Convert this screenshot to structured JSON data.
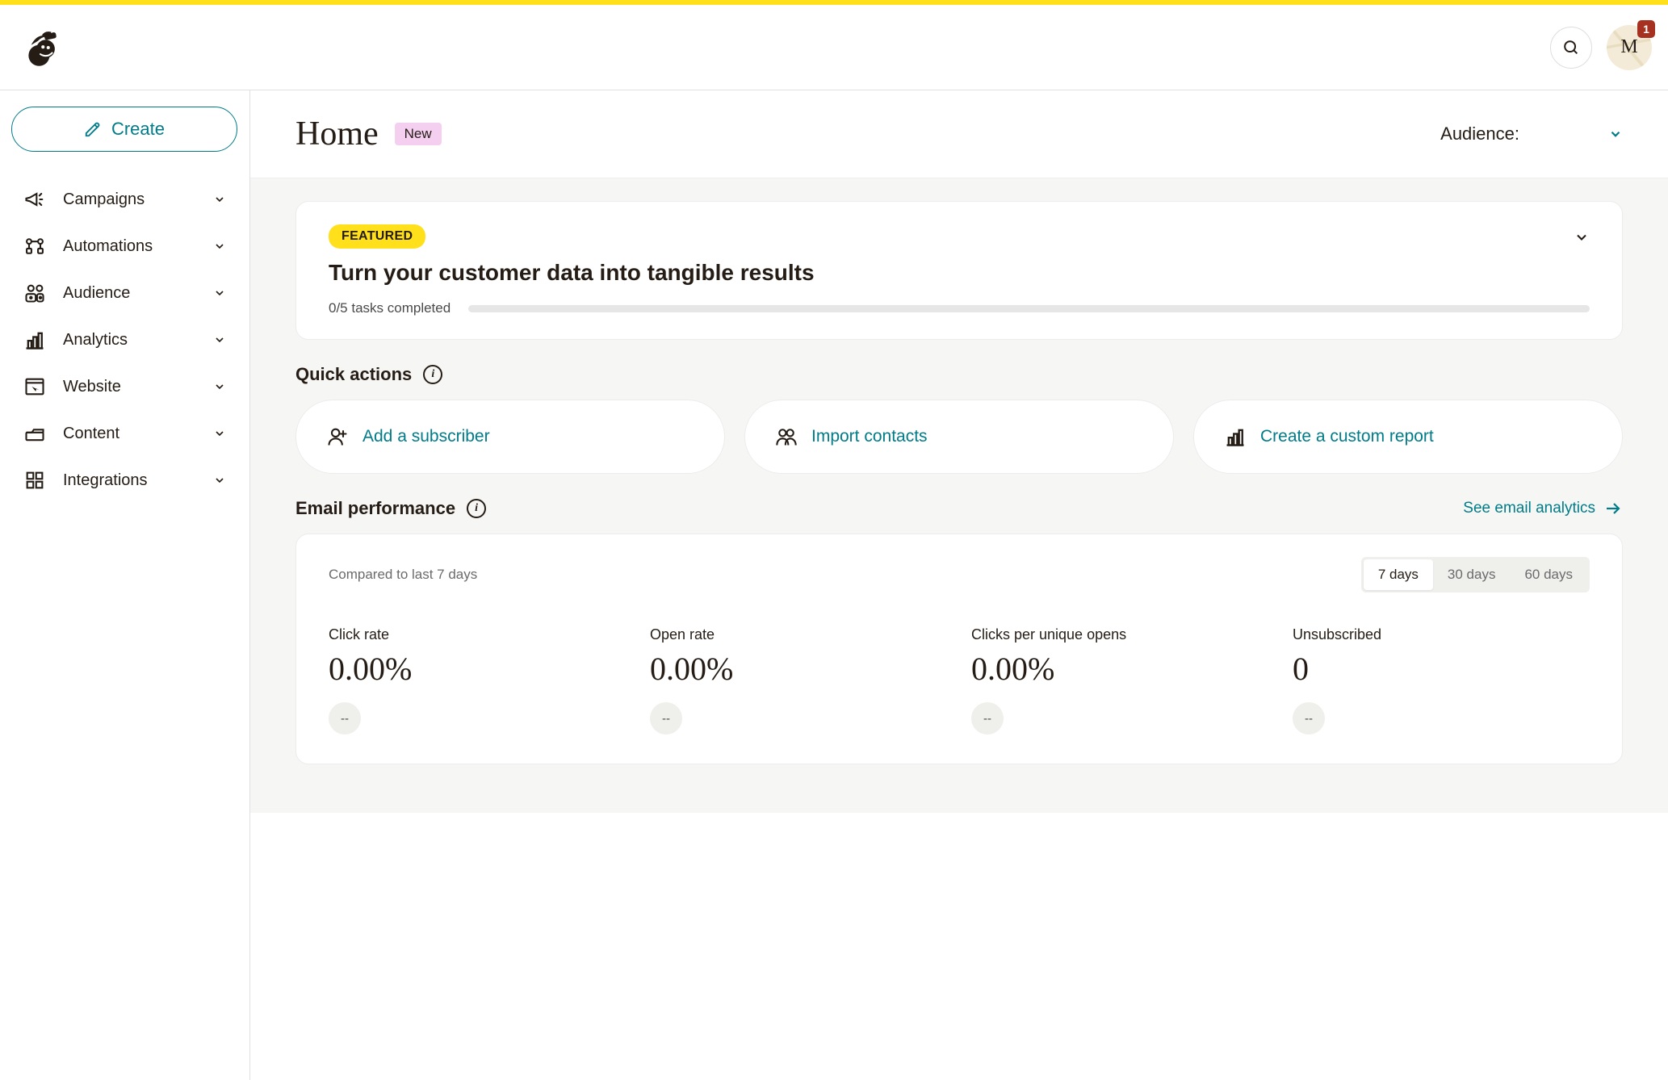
{
  "header": {
    "avatar_letter": "M",
    "badge_count": "1"
  },
  "sidebar": {
    "create_label": "Create",
    "items": [
      {
        "label": "Campaigns"
      },
      {
        "label": "Automations"
      },
      {
        "label": "Audience"
      },
      {
        "label": "Analytics"
      },
      {
        "label": "Website"
      },
      {
        "label": "Content"
      },
      {
        "label": "Integrations"
      }
    ]
  },
  "main": {
    "title": "Home",
    "new_badge": "New",
    "audience_label": "Audience:"
  },
  "featured": {
    "tag": "FEATURED",
    "title": "Turn your customer data into tangible results",
    "progress_text": "0/5 tasks completed"
  },
  "quick_actions": {
    "title": "Quick actions",
    "items": [
      {
        "label": "Add a subscriber"
      },
      {
        "label": "Import contacts"
      },
      {
        "label": "Create a custom report"
      }
    ]
  },
  "email_perf": {
    "title": "Email performance",
    "see_link": "See email analytics",
    "compared_text": "Compared to last 7 days",
    "tabs": [
      {
        "label": "7 days",
        "active": true
      },
      {
        "label": "30 days",
        "active": false
      },
      {
        "label": "60 days",
        "active": false
      }
    ],
    "metrics": [
      {
        "label": "Click rate",
        "value": "0.00%",
        "delta": "--"
      },
      {
        "label": "Open rate",
        "value": "0.00%",
        "delta": "--"
      },
      {
        "label": "Clicks per unique opens",
        "value": "0.00%",
        "delta": "--"
      },
      {
        "label": "Unsubscribed",
        "value": "0",
        "delta": "--"
      }
    ]
  }
}
